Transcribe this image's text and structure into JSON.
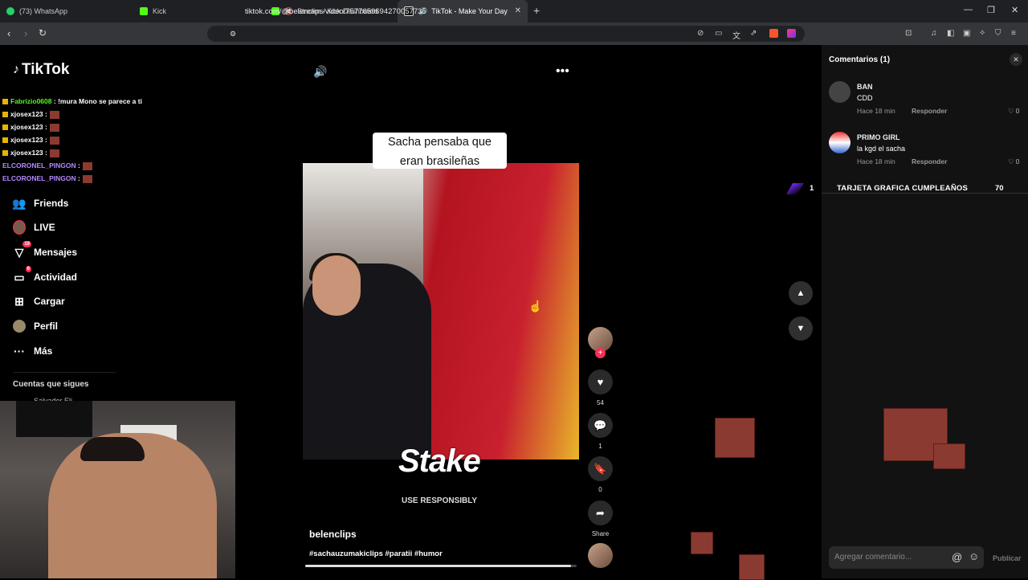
{
  "browser": {
    "tabs": [
      {
        "title": "(73) WhatsApp",
        "favicon": "whatsapp-icon",
        "active": false
      },
      {
        "title": "Kick",
        "favicon": "kick-icon",
        "active": false,
        "muted": true
      },
      {
        "title": "Stream - Kick Dashboard",
        "favicon": "kick-icon",
        "active": false,
        "muted": true
      },
      {
        "title": "TikTok - Make Your Day",
        "favicon": "tiktok-icon",
        "active": true,
        "sound": true
      }
    ],
    "url": "tiktok.com/@belenclips/video/7577659694270057735"
  },
  "tiktok": {
    "logo": "TikTok",
    "nav": [
      {
        "label": "Friends",
        "icon": "friends-icon",
        "badge": ""
      },
      {
        "label": "LIVE",
        "icon": "live-icon",
        "badge": ""
      },
      {
        "label": "Mensajes",
        "icon": "messages-icon",
        "badge": "19"
      },
      {
        "label": "Actividad",
        "icon": "activity-icon",
        "badge": "6"
      },
      {
        "label": "Cargar",
        "icon": "upload-icon",
        "badge": ""
      },
      {
        "label": "Perfil",
        "icon": "profile-icon",
        "badge": ""
      },
      {
        "label": "Más",
        "icon": "more-icon",
        "badge": ""
      }
    ],
    "following_title": "Cuentas que sigues",
    "following_first": "Salvador Eli"
  },
  "chat": [
    {
      "user": "Fabrizio0608",
      "text": ": !mura Mono se parece a ti",
      "color": "#53fc18"
    },
    {
      "user": "xjosex123",
      "text": ":",
      "color": "#ffffff",
      "emote": true
    },
    {
      "user": "xjosex123",
      "text": ":",
      "color": "#ffffff",
      "emote": true
    },
    {
      "user": "xjosex123",
      "text": ":",
      "color": "#ffffff",
      "emote": true
    },
    {
      "user": "xjosex123",
      "text": ":",
      "color": "#ffffff",
      "emote": true
    },
    {
      "user": "ELCORONEL_PINGON",
      "text": ":",
      "color": "#b388ff",
      "emote": true
    },
    {
      "user": "ELCORONEL_PINGON",
      "text": ":",
      "color": "#b388ff",
      "emote": true
    }
  ],
  "video": {
    "caption_line1": "Sacha pensaba que",
    "caption_line2": "eran brasileñas",
    "sponsor": "Stake",
    "sponsor_sub": "USE RESPONSIBLY",
    "author": "belenclips",
    "hashtags": "#sachauzumakiclips #paratii #humor",
    "progress_fraction": 0.98,
    "likes": "54",
    "comments": "1",
    "saves": "0",
    "share_label": "Share"
  },
  "comments": {
    "title": "Comentarios (1)",
    "items": [
      {
        "user": "BAN",
        "text": "CDD",
        "time": "Hace 18 min",
        "reply": "Responder",
        "likes": "0"
      },
      {
        "user": "PRIMO GIRL",
        "text": "la kgd el sacha",
        "time": "Hace 18 min",
        "reply": "Responder",
        "likes": "0"
      }
    ],
    "overlay_label": "TARJETA GRAFICA CUMPLEAÑOS",
    "overlay_count": "70",
    "overlay_one": "1",
    "input_placeholder": "Agregar comentario...",
    "publish_label": "Publicar"
  }
}
